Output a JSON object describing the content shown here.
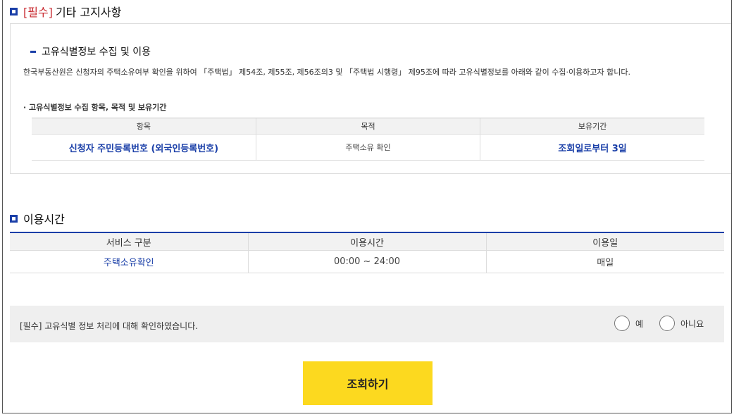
{
  "section1": {
    "required_tag": "[필수]",
    "title": "기타 고지사항",
    "sub_title": "고유식별정보 수집 및 이용",
    "description": "한국부동산원은 신청자의 주택소유여부 확인을 위하여 「주택법」 제54조, 제55조, 제56조의3 및 「주택법 시행령」 제95조에 따라 고유식별정보를 아래와 같이 수집·이용하고자 합니다.",
    "bullet": "· 고유식별정보 수집 항목, 목적 및 보유기간",
    "table": {
      "headers": [
        "항목",
        "목적",
        "보유기간"
      ],
      "row": [
        "신청자 주민등록번호 (외국인등록번호)",
        "주택소유 확인",
        "조회일로부터 3일"
      ]
    }
  },
  "section2": {
    "title": "이용시간",
    "table": {
      "headers": [
        "서비스 구분",
        "이용시간",
        "이용일"
      ],
      "row": [
        "주택소유확인",
        "00:00 ~ 24:00",
        "매일"
      ]
    }
  },
  "consent": {
    "text": "[필수] 고유식별 정보 처리에 대해 확인하였습니다.",
    "yes_label": "예",
    "no_label": "아니요"
  },
  "search_button": "조회하기",
  "colors": {
    "accent": "#1a3fa8",
    "required": "#c8282e",
    "button": "#fcd91f"
  }
}
